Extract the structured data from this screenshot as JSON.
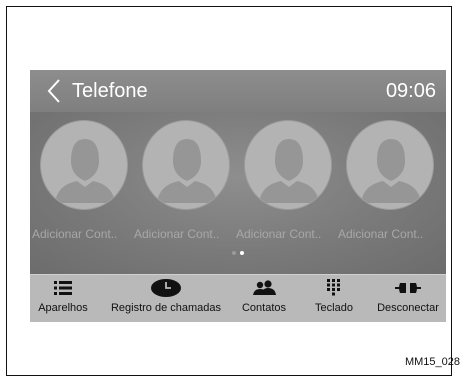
{
  "header": {
    "title": "Telefone",
    "time": "09:06",
    "back_icon": "chevron-left-icon"
  },
  "contacts": [
    {
      "label": "Adicionar Cont..",
      "icon": "person-silhouette-icon"
    },
    {
      "label": "Adicionar Cont..",
      "icon": "person-silhouette-icon"
    },
    {
      "label": "Adicionar Cont..",
      "icon": "person-silhouette-icon"
    },
    {
      "label": "Adicionar Cont..",
      "icon": "person-silhouette-icon"
    }
  ],
  "pager": {
    "pages": 2,
    "active": 2
  },
  "toolbar": {
    "items": [
      {
        "label": "Aparelhos",
        "icon": "list-icon"
      },
      {
        "label": "Registro de chamadas",
        "icon": "clock-icon"
      },
      {
        "label": "Contatos",
        "icon": "contacts-icon"
      },
      {
        "label": "Teclado",
        "icon": "keypad-icon"
      },
      {
        "label": "Desconectar",
        "icon": "disconnect-icon"
      }
    ]
  },
  "caption": "MM15_028",
  "colors": {
    "header_bg": "#878787",
    "content_bg": "#7a7a7a",
    "toolbar_bg": "#b9b9b9",
    "avatar_bg": "#b3b3b3",
    "contact_label": "#a8a8a8"
  }
}
